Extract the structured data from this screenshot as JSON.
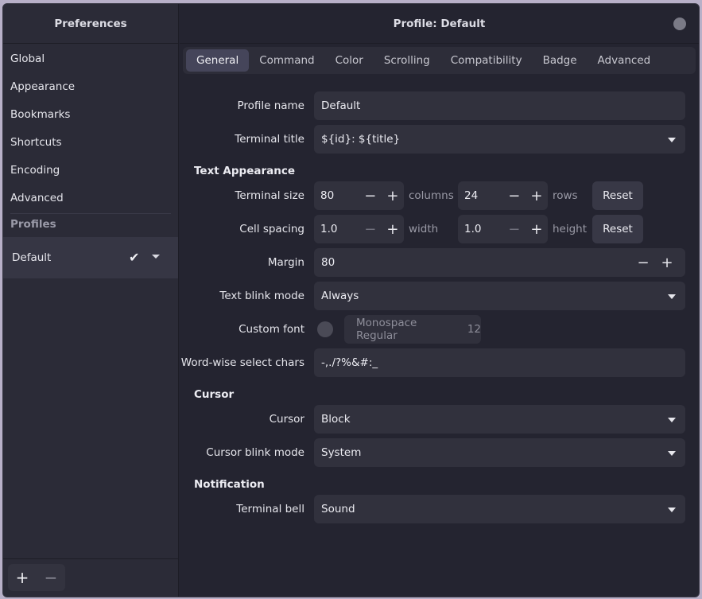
{
  "sidebar": {
    "title": "Preferences",
    "items": [
      {
        "label": "Global"
      },
      {
        "label": "Appearance"
      },
      {
        "label": "Bookmarks"
      },
      {
        "label": "Shortcuts"
      },
      {
        "label": "Encoding"
      },
      {
        "label": "Advanced"
      }
    ],
    "profiles_heading": "Profiles",
    "profile": {
      "label": "Default",
      "check": "✔"
    },
    "add_label": "+",
    "remove_label": "−"
  },
  "header": {
    "title": "Profile: Default"
  },
  "tabs": [
    {
      "label": "General",
      "active": true
    },
    {
      "label": "Command"
    },
    {
      "label": "Color"
    },
    {
      "label": "Scrolling"
    },
    {
      "label": "Compatibility"
    },
    {
      "label": "Badge"
    },
    {
      "label": "Advanced"
    }
  ],
  "form": {
    "profile_name": {
      "label": "Profile name",
      "value": "Default"
    },
    "terminal_title": {
      "label": "Terminal title",
      "value": "${id}: ${title}"
    },
    "text_appearance_heading": "Text Appearance",
    "terminal_size": {
      "label": "Terminal size",
      "columns": "80",
      "columns_unit": "columns",
      "rows": "24",
      "rows_unit": "rows",
      "reset": "Reset"
    },
    "cell_spacing": {
      "label": "Cell spacing",
      "width": "1.0",
      "width_unit": "width",
      "height": "1.0",
      "height_unit": "height",
      "reset": "Reset"
    },
    "margin": {
      "label": "Margin",
      "value": "80"
    },
    "text_blink_mode": {
      "label": "Text blink mode",
      "value": "Always"
    },
    "custom_font": {
      "label": "Custom font",
      "font": "Monospace Regular",
      "size": "12"
    },
    "word_select": {
      "label": "Word-wise select chars",
      "value": "-,./?%&#:_"
    },
    "cursor_heading": "Cursor",
    "cursor": {
      "label": "Cursor",
      "value": "Block"
    },
    "cursor_blink_mode": {
      "label": "Cursor blink mode",
      "value": "System"
    },
    "notification_heading": "Notification",
    "terminal_bell": {
      "label": "Terminal bell",
      "value": "Sound"
    },
    "minus": "−",
    "plus": "+"
  }
}
